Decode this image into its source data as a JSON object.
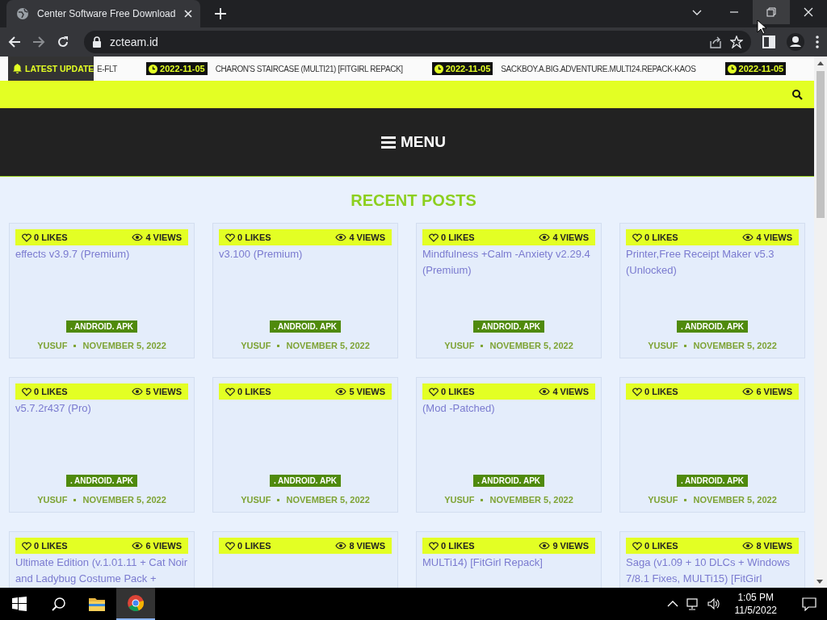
{
  "browser": {
    "tab_title": "Center Software Free Download",
    "url": "zcteam.id"
  },
  "ticker": {
    "label": "LATEST UPDATE",
    "items": [
      {
        "text": "E-FLT"
      },
      {
        "date": "2022-11-05",
        "text": "CHARON'S STAIRCASE (MULTI21) [FITGIRL REPACK]"
      },
      {
        "date": "2022-11-05",
        "text": "SACKBOY.A.BIG.ADVENTURE.MULTI24.REPACK-KAOS"
      },
      {
        "date": "2022-11-05"
      }
    ]
  },
  "menu": {
    "label": "MENU"
  },
  "section_title": "RECENT POSTS",
  "posts": [
    {
      "likes": "0 LIKES",
      "views": "4 VIEWS",
      "title": "effects v3.9.7 (Premium)",
      "category": ". ANDROID. APK",
      "author": "YUSUF",
      "date": "NOVEMBER 5, 2022"
    },
    {
      "likes": "0 LIKES",
      "views": "4 VIEWS",
      "title": "v3.100 (Premium)",
      "category": ". ANDROID. APK",
      "author": "YUSUF",
      "date": "NOVEMBER 5, 2022"
    },
    {
      "likes": "0 LIKES",
      "views": "4 VIEWS",
      "title": "Mindfulness +Calm -Anxiety v2.29.4 (Premium)",
      "category": ". ANDROID. APK",
      "author": "YUSUF",
      "date": "NOVEMBER 5, 2022"
    },
    {
      "likes": "0 LIKES",
      "views": "4 VIEWS",
      "title": "Printer,Free Receipt Maker v5.3 (Unlocked)",
      "category": ". ANDROID. APK",
      "author": "YUSUF",
      "date": "NOVEMBER 5, 2022"
    },
    {
      "likes": "0 LIKES",
      "views": "5 VIEWS",
      "title": "v5.7.2r437 (Pro)",
      "category": ". ANDROID. APK",
      "author": "YUSUF",
      "date": "NOVEMBER 5, 2022"
    },
    {
      "likes": "0 LIKES",
      "views": "5 VIEWS",
      "category": ". ANDROID. APK",
      "author": "YUSUF",
      "date": "NOVEMBER 5, 2022"
    },
    {
      "likes": "0 LIKES",
      "views": "4 VIEWS",
      "title": "(Mod -Patched)",
      "category": ". ANDROID. APK",
      "author": "YUSUF",
      "date": "NOVEMBER 5, 2022"
    },
    {
      "likes": "0 LIKES",
      "views": "6 VIEWS",
      "category": ". ANDROID. APK",
      "author": "YUSUF",
      "date": "NOVEMBER 5, 2022"
    },
    {
      "likes": "0 LIKES",
      "views": "6 VIEWS",
      "title": "Ultimate Edition (v.1.01.11 + Cat Noir and Ladybug Costume Pack +"
    },
    {
      "likes": "0 LIKES",
      "views": "8 VIEWS"
    },
    {
      "likes": "0 LIKES",
      "views": "9 VIEWS",
      "title": "MULTi14) [FitGirl Repack]"
    },
    {
      "likes": "0 LIKES",
      "views": "8 VIEWS",
      "title": "Saga (v1.09 + 10 DLCs + Windows 7/8.1 Fixes, MULTi15) [FitGirl"
    }
  ],
  "taskbar": {
    "time": "1:05 PM",
    "date": "11/5/2022"
  }
}
